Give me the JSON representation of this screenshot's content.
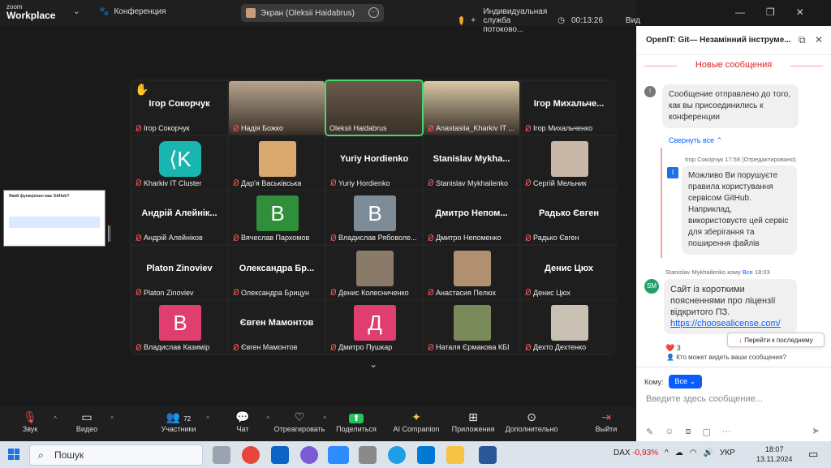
{
  "topbar": {
    "brand_small": "zoom",
    "brand_big": "Workplace",
    "conference": "Конференция",
    "screen_share": "Экран (Oleksii Haidabrus)",
    "service": "Индивидуальная служба потоково...",
    "timer": "00:13:26",
    "view": "Вид"
  },
  "tiles": [
    {
      "big": "Ігор Сокорчук",
      "name": "Ігор Сокорчук",
      "hand": "✋"
    },
    {
      "name": "Надія Божко",
      "kind": "video"
    },
    {
      "name": "Oleksii Haidabrus",
      "kind": "video"
    },
    {
      "name": "Anastasiia_Kharkiv IT ...",
      "kind": "video"
    },
    {
      "big": "Ігор  Михальче...",
      "name": "Ігор Михальченко"
    },
    {
      "name": "Kharkiv IT Cluster",
      "kind": "logo"
    },
    {
      "name": "Дар'я Васьківська",
      "kind": "photo"
    },
    {
      "big": "Yuriy Hordienko",
      "name": "Yuriy Hordienko"
    },
    {
      "big": "Stanislav  Mykha...",
      "name": "Stanislav Mykhailenko"
    },
    {
      "name": "Сергій Мельник",
      "kind": "photo"
    },
    {
      "big": "Андрій  Алейнік...",
      "name": "Андрій Алейніков"
    },
    {
      "name": "Вячеслав Пархомов",
      "kind": "letter",
      "letter": "В"
    },
    {
      "name": "Владислав Рябоволе...",
      "kind": "letter",
      "letter": "В"
    },
    {
      "big": "Дмитро  Непом...",
      "name": "Дмитро Непоменко"
    },
    {
      "big": "Радько Євген",
      "name": "Радько Євген"
    },
    {
      "big": "Platon Zinoviev",
      "name": "Platon Zinoviev"
    },
    {
      "big": "Олександра  Бр...",
      "name": "Олександра Брицун"
    },
    {
      "name": "Денис Колесниченко",
      "kind": "photo"
    },
    {
      "name": "Анастасия Пелюх",
      "kind": "photo"
    },
    {
      "big": "Денис Цюх",
      "name": "Денис Цюх"
    },
    {
      "name": "Владислав Казимір",
      "kind": "letter",
      "letter": "В"
    },
    {
      "big": "Євген Мамонтов",
      "name": "Євген Мамонтов"
    },
    {
      "name": "Дмитро Пушкар",
      "kind": "letter",
      "letter": "Д"
    },
    {
      "name": "Наталя Єрмакова КБІ",
      "kind": "photo"
    },
    {
      "name": "Дехто Дехтенко",
      "kind": "photo"
    }
  ],
  "share_thumb": {
    "title": "Який функціонал має GitHub?"
  },
  "toolbar": {
    "audio": "Звук",
    "video": "Видео",
    "participants": "Участники",
    "participants_count": "72",
    "chat": "Чат",
    "react": "Отреагировать",
    "share": "Поделиться",
    "ai": "AI Companion",
    "apps": "Приложения",
    "more": "Дополнительно",
    "leave": "Выйти"
  },
  "chat": {
    "title": "OpenIT: Git— Незамінний інструме...",
    "new_messages": "Новые сообщения",
    "system_msg": "Сообщение отправлено до того, как вы присоединились к конференции",
    "collapse": "Свернуть все",
    "msg1_meta": "Ігор Сокорчук 17:58 (Отредактировано)",
    "msg1_avatar": "I",
    "msg1_text": "Можливо Ви порушуєте правила користування сервісом GitHub. Наприклад, використовуєте цей сервіс для зберігання та поширення файлів",
    "msg2_sender": "Stanislav Mykhailenko",
    "msg2_kom": "кому",
    "msg2_to": "Все",
    "msg2_time": "18:03",
    "msg2_avatar": "SM",
    "msg2_text": "Сайт із короткими поясненнями про ліцензії відкритого ПЗ.",
    "msg2_link": "https://choosealicense.com/",
    "reaction": "❤️ 3",
    "jump": "Перейти к последнему",
    "who_can_see": "Кто может видеть ваши сообщения?",
    "to_label": "Кому:",
    "to_value": "Все",
    "input_placeholder": "Введите здесь сообщение..."
  },
  "taskbar": {
    "search": "Пошук",
    "dax": "DAX",
    "dax_change": "-0,93%",
    "lang": "УКР",
    "time": "18:07",
    "date": "13.11.2024"
  },
  "colors": {
    "accent": "#0b5cff",
    "danger": "#e02424",
    "active_speaker": "#3fdc6a"
  }
}
